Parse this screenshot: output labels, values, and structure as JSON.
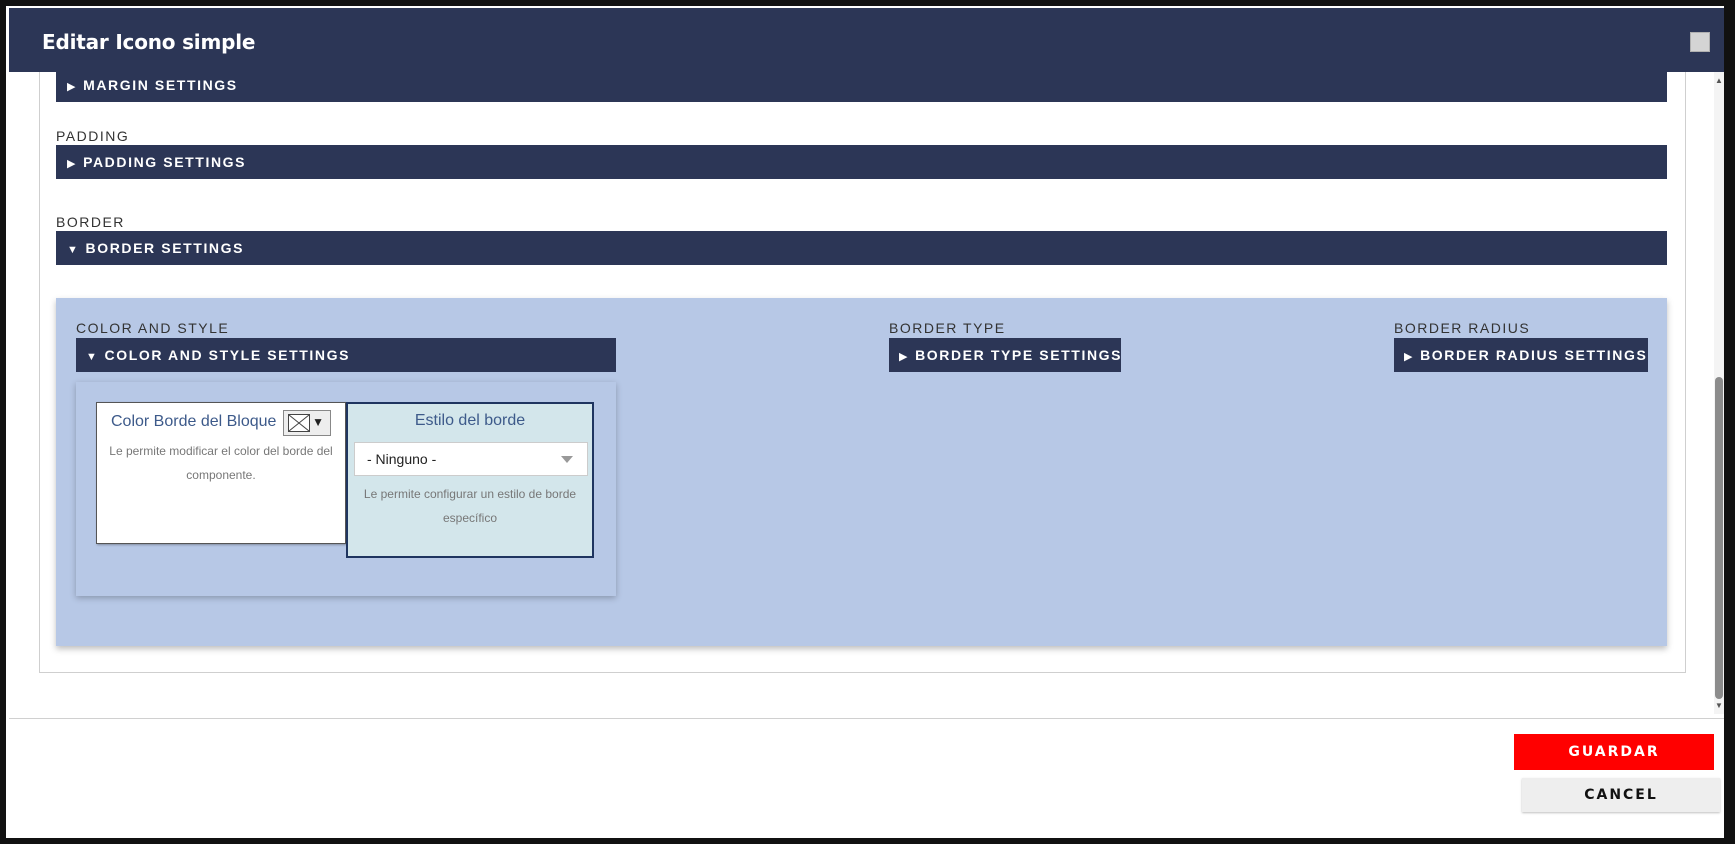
{
  "dialog": {
    "title": "Editar Icono simple",
    "close_icon": "square-close-icon"
  },
  "sections": {
    "margin": {
      "bar_label": "MARGIN SETTINGS",
      "expanded": false
    },
    "padding": {
      "label": "PADDING",
      "bar_label": "PADDING SETTINGS",
      "expanded": false
    },
    "border": {
      "label": "BORDER",
      "bar_label": "BORDER SETTINGS",
      "expanded": true
    }
  },
  "border_panel": {
    "color_style": {
      "label": "COLOR AND STYLE",
      "bar_label": "COLOR AND STYLE SETTINGS",
      "expanded": true
    },
    "border_type": {
      "label": "BORDER TYPE",
      "bar_label": "BORDER TYPE SETTINGS",
      "expanded": false
    },
    "border_radius": {
      "label": "BORDER RADIUS",
      "bar_label": "BORDER RADIUS SETTINGS",
      "expanded": false
    }
  },
  "color_card": {
    "title": "Color Borde del Bloque",
    "description": "Le permite modificar el color del borde del componente.",
    "picker_icon": "no-color-swatch-icon"
  },
  "style_card": {
    "title": "Estilo del borde",
    "selected": "- Ninguno -",
    "description": "Le permite configurar un estilo de borde específico"
  },
  "footer": {
    "save_label": "GUARDAR",
    "cancel_label": "CANCEL"
  },
  "colors": {
    "header_bg": "#2c3656",
    "panel_bg": "#b7c8e6",
    "style_card_bg": "#d3e6eb",
    "save_bg": "#ff0000"
  }
}
